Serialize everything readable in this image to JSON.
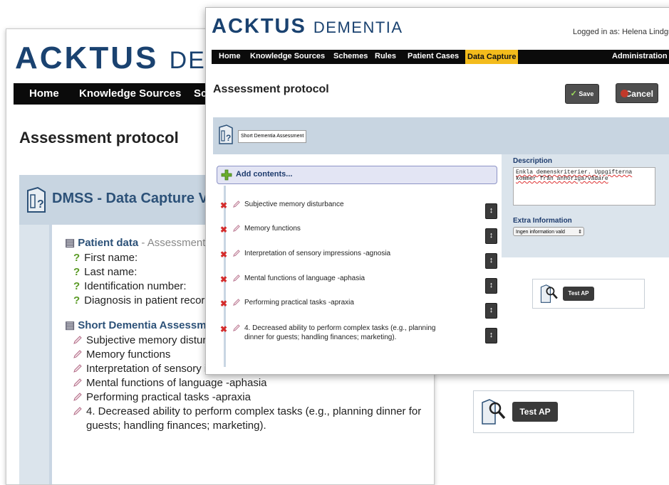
{
  "colors": {
    "brand": "#1a4270",
    "nav_bg": "#0b0b0b",
    "nav_active": "#f3bb1c",
    "panel": "#dbe4ec",
    "delete": "#d42c2c",
    "add": "#5a9a25"
  },
  "back": {
    "logo_main": "ACKTUS",
    "logo_sub": "DE",
    "nav": [
      "Home",
      "Knowledge Sources",
      "Sch"
    ],
    "page_title": "Assessment protocol",
    "panel_title": "DMSS - Data Capture Vi",
    "patient_section": {
      "title": "Patient data",
      "subtitle": "- Assessment Prot",
      "fields": [
        "First name:",
        "Last name:",
        "Identification number:",
        "Diagnosis in patient record:"
      ]
    },
    "assessment_section": {
      "title": "Short Dementia Assessment -",
      "items": [
        "Subjective memory disturbanc",
        "Memory functions",
        "Interpretation of sensory impressions -agnosia",
        "Mental functions of language -aphasia",
        "Performing practical tasks -apraxia",
        "4. Decreased ability to perform complex tasks (e.g., planning dinner for",
        "guests; handling finances; marketing)."
      ]
    },
    "test_button": "Test AP"
  },
  "front": {
    "logo_main": "ACKTUS",
    "logo_sub": "DEMENTIA",
    "logged_in": "Logged in as: Helena Lindgren",
    "nav": [
      "Home",
      "Knowledge Sources",
      "Schemes",
      "Rules",
      "Patient Cases",
      "Data Capture"
    ],
    "nav_right": "Administration",
    "page_title": "Assessment protocol",
    "save_label": "Save",
    "cancel_label": "Cancel",
    "protocol_name": "Short Dementia Assessment",
    "add_contents": "Add contents...",
    "items": [
      "Subjective memory disturbance",
      "Memory functions",
      "Interpretation of sensory impressions -agnosia",
      "Mental functions of language -aphasia",
      "Performing practical tasks -apraxia",
      "4. Decreased ability to perform complex tasks (e.g., planning",
      "dinner for guests; handling finances; marketing)."
    ],
    "description_label": "Description",
    "description_line1": "Enkla demenskriterier. Uppgifterna",
    "description_line2": "kommer från anhöriga/vådare",
    "extra_label": "Extra Information",
    "extra_select": "Ingen information vald",
    "test_button": "Test AP"
  }
}
